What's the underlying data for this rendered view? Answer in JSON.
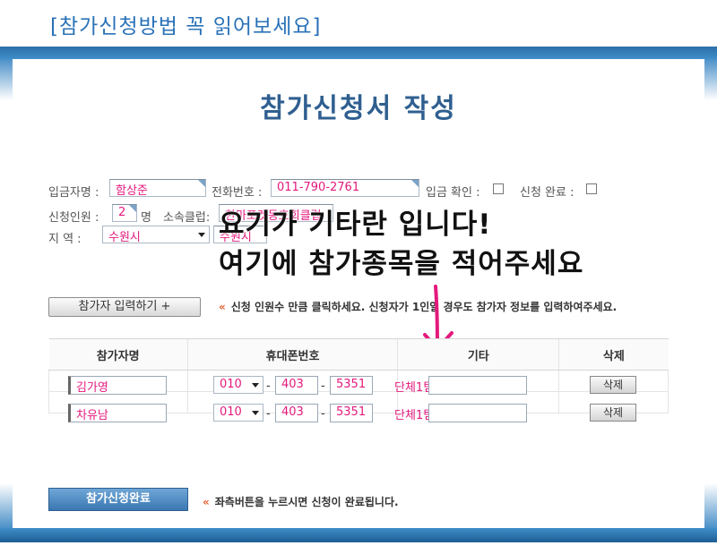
{
  "caption": "[참가신청방법 꼭 읽어보세요]",
  "form_title": "참가신청서 작성",
  "fields": {
    "payer_label": "입금자명 :",
    "payer_value": "함상준",
    "phone_label": "전화번호 :",
    "phone_value": "011-790-2761",
    "deposit_check_label": "입금 확인 :",
    "apply_done_label": "신청 완료 :",
    "count_label": "신청인원 :",
    "count_value": "2",
    "count_unit": "명",
    "club_label": "소속클럽:",
    "club_value": "한마포켓동호회클럽",
    "region_label": "지      역 :",
    "region_select": "수원시",
    "region_value": "수원시"
  },
  "overlay": {
    "line1": "요기가 기타란 입니다!",
    "line2": "여기에 참가종목을 적어주세요"
  },
  "add_button": "참가자 입력하기 +",
  "notice_add": "신청 인원수 만큼 클릭하세요.  신청자가 1인일 경우도 참가자 정보를 입력하여주세요.",
  "table": {
    "headers": [
      "참가자명",
      "휴대폰번호",
      "기타",
      "삭제"
    ],
    "rows": [
      {
        "name": "김가영",
        "phone1": "010",
        "phone2": "403",
        "phone3": "5351",
        "etc": "단체1팀",
        "delete": "삭제"
      },
      {
        "name": "차유남",
        "phone1": "010",
        "phone2": "403",
        "phone3": "5351",
        "etc": "단체1팀",
        "delete": "삭제"
      }
    ],
    "dash": "-"
  },
  "done_button": "참가신청완료",
  "notice_done": "좌측버튼을 누르시면 신청이 완료됩니다.",
  "notice_chevron": "«",
  "colors": {
    "accent": "#2a72b8",
    "value_text": "#e4197c",
    "frame": "#3f8ec9"
  }
}
